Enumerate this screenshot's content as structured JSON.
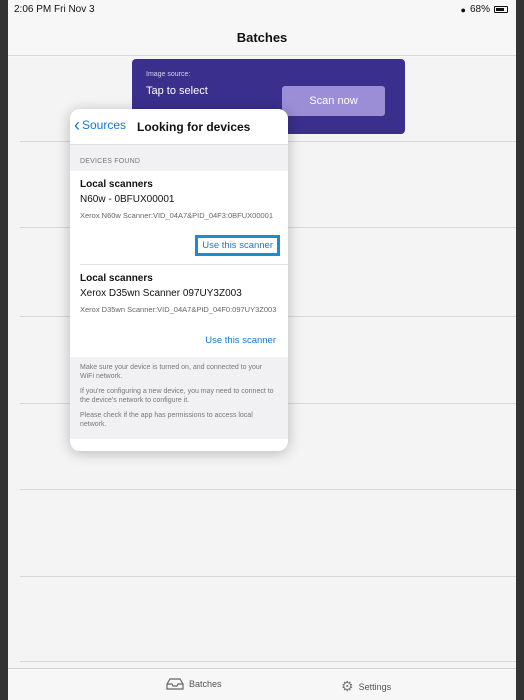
{
  "status": {
    "time": "2:06 PM  Fri Nov 3",
    "battery": "68%"
  },
  "nav": {
    "title": "Batches"
  },
  "banner": {
    "image_source_label": "Image source:",
    "image_source_value": "Tap to select",
    "scan_button": "Scan now"
  },
  "popover": {
    "back_label": "Sources",
    "title": "Looking for devices",
    "section_header": "DEVICES FOUND",
    "devices": [
      {
        "title": "Local scanners",
        "name": "N60w - 0BFUX00001",
        "detail": "Xerox N60w Scanner:VID_04A7&PID_04F3:0BFUX00001",
        "action": "Use this scanner"
      },
      {
        "title": "Local scanners",
        "name": "Xerox D35wn Scanner 097UY3Z003",
        "detail": "Xerox D35wn Scanner:VID_04A7&PID_04F0:097UY3Z003",
        "action": "Use this scanner"
      }
    ],
    "notes": [
      "Make sure your device is turned on, and connected to your WiFi network.",
      "If you're configuring a new device, you may need to connect to the device's network to configure it.",
      "Please check if the app has permissions to access local network."
    ]
  },
  "tabbar": {
    "batches": "Batches",
    "settings": "Settings"
  },
  "colors": {
    "banner": "#3a2f8c",
    "accent": "#1677d2",
    "highlight": "#1e8ad6"
  }
}
